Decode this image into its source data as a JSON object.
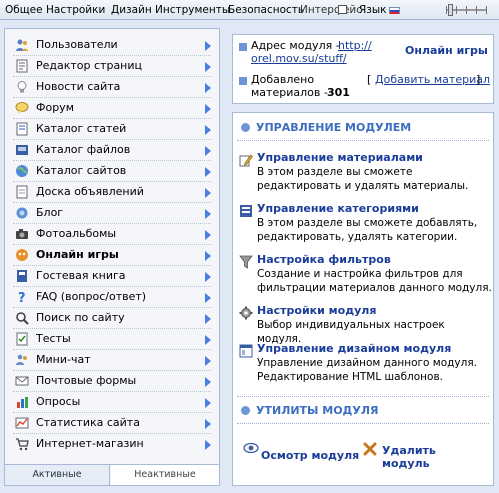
{
  "topmenu": {
    "items": [
      "Общее",
      "Настройки",
      "Дизайн",
      "Инструменты",
      "Безопасность"
    ],
    "overlap_label": "Интерфейс",
    "language_label": "Язык"
  },
  "sidebar": {
    "items": [
      {
        "label": "Пользователи",
        "icon": "users-icon"
      },
      {
        "label": "Редактор страниц",
        "icon": "page-editor-icon"
      },
      {
        "label": "Новости сайта",
        "icon": "news-lightbulb-icon"
      },
      {
        "label": "Форум",
        "icon": "forum-icon"
      },
      {
        "label": "Каталог статей",
        "icon": "articles-icon"
      },
      {
        "label": "Каталог файлов",
        "icon": "files-icon"
      },
      {
        "label": "Каталог сайтов",
        "icon": "sites-globe-icon"
      },
      {
        "label": "Доска объявлений",
        "icon": "board-icon"
      },
      {
        "label": "Блог",
        "icon": "blog-icon"
      },
      {
        "label": "Фотоальбомы",
        "icon": "camera-icon"
      },
      {
        "label": "Онлайн игры",
        "icon": "games-icon"
      },
      {
        "label": "Гостевая книга",
        "icon": "guestbook-icon"
      },
      {
        "label": "FAQ (вопрос/ответ)",
        "icon": "faq-icon"
      },
      {
        "label": "Поиск по сайту",
        "icon": "search-icon"
      },
      {
        "label": "Тесты",
        "icon": "tests-icon"
      },
      {
        "label": "Мини-чат",
        "icon": "chat-icon"
      },
      {
        "label": "Почтовые формы",
        "icon": "mail-icon"
      },
      {
        "label": "Опросы",
        "icon": "poll-icon"
      },
      {
        "label": "Статистика сайта",
        "icon": "stats-icon"
      },
      {
        "label": "Интернет-магазин",
        "icon": "shop-cart-icon"
      }
    ],
    "tabs": {
      "active": "Активные",
      "inactive": "Неактивные"
    }
  },
  "info": {
    "address_label": "Адрес модуля -",
    "address_link_line1": "http://",
    "address_link_line2": "orel.mov.su/stuff/",
    "module_name": "Онлайн игры",
    "added_line1": "Добавлено",
    "added_line2": "материалов -",
    "added_count": "301",
    "add_material_link": "Добавить материал",
    "bracket_open": "[",
    "bracket_close": "]"
  },
  "manage": {
    "section_title": "УПРАВЛЕНИЕ МОДУЛЕМ",
    "entries": [
      {
        "title": "Управление материалами",
        "desc": "В этом разделе вы сможете редактировать и удалять материалы.",
        "icon": "pencil-icon"
      },
      {
        "title": "Управление категориями",
        "desc": "В этом разделе вы сможете добавлять, редактировать, удалять категории.",
        "icon": "categories-icon"
      },
      {
        "title": "Настройка фильтров",
        "desc": "Создание и настройка фильтров для фильтрации материалов данного модуля.",
        "icon": "filter-icon"
      },
      {
        "title": "Настройки модуля",
        "desc": "Выбор индивидуальных настроек модуля.",
        "icon": "gear-icon"
      },
      {
        "title": "Управление дизайном модуля",
        "desc": "Управление дизайном данного модуля. Редактирование HTML шаблонов.",
        "icon": "design-icon"
      }
    ]
  },
  "utils": {
    "section_title": "УТИЛИТЫ МОДУЛЯ",
    "inspect": "Осмотр модуля",
    "delete_line1": "Удалить",
    "delete_line2": "модуль"
  },
  "colors": {
    "accent": "#3d6dc0",
    "link": "#1a3d9a",
    "arrow": "#4a7fe0"
  }
}
